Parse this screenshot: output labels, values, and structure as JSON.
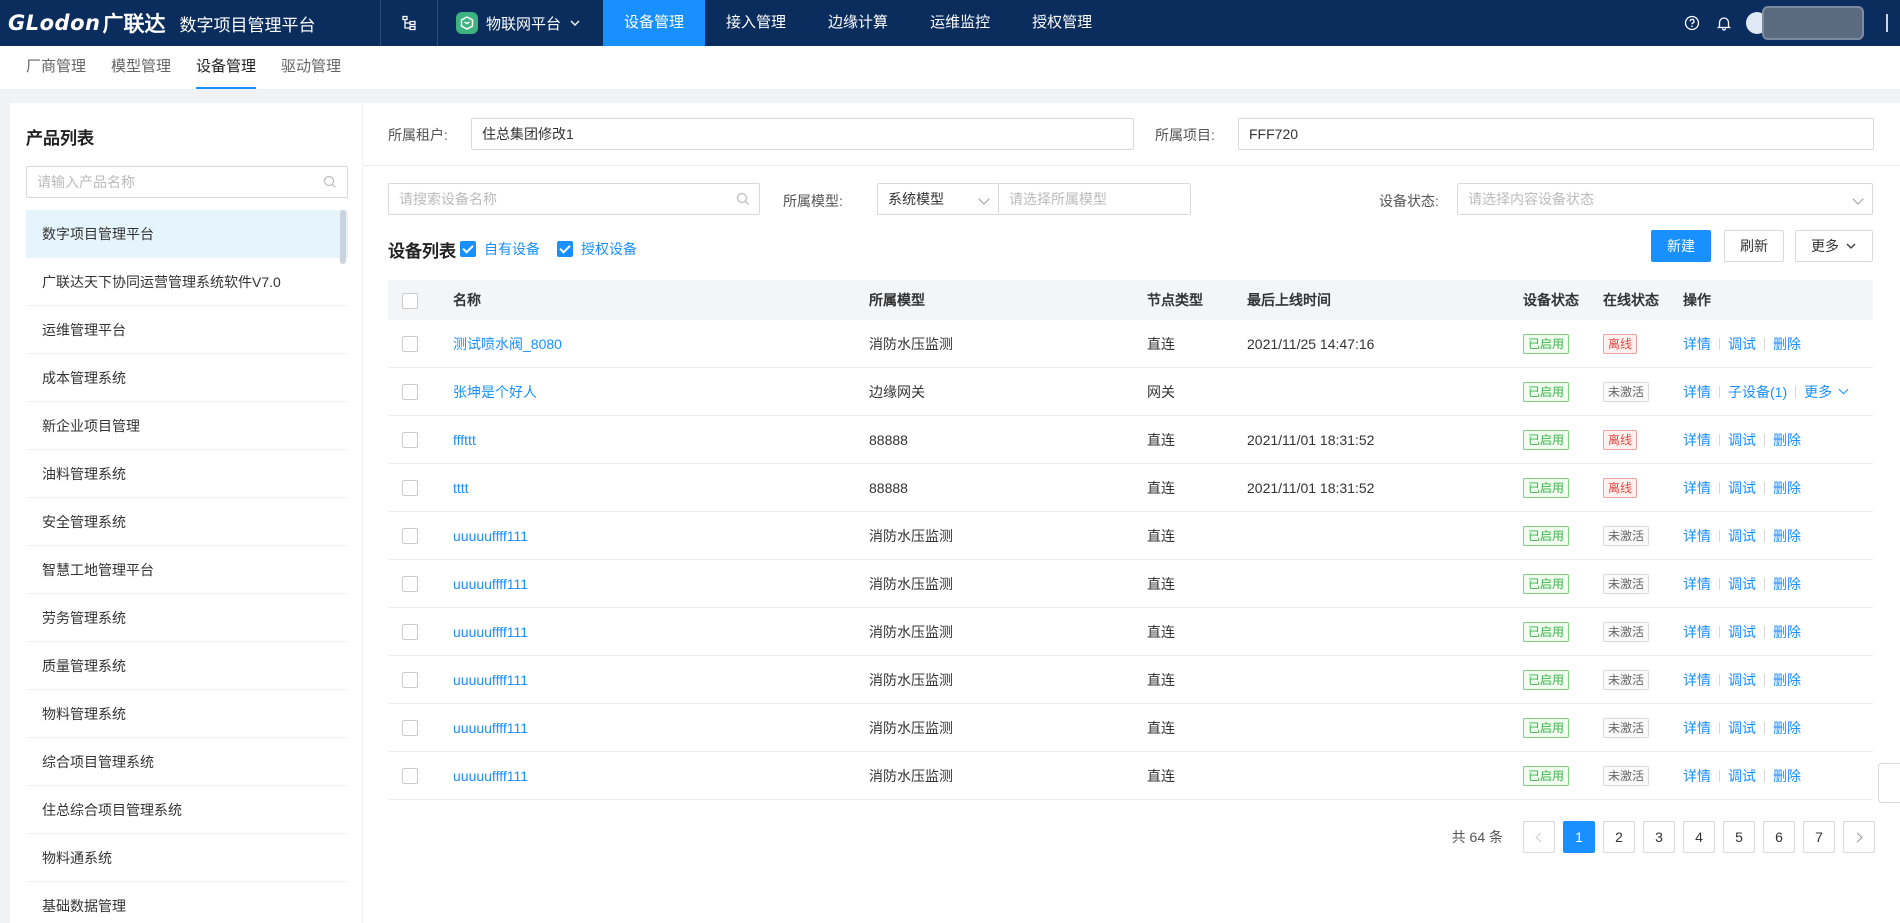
{
  "topbar": {
    "logo_mark": "GLodon",
    "logo_cn": "广联达",
    "app_title": "数字项目管理平台",
    "platform_label": "物联网平台",
    "nav": [
      {
        "label": "设备管理",
        "active": true
      },
      {
        "label": "接入管理",
        "active": false
      },
      {
        "label": "边缘计算",
        "active": false
      },
      {
        "label": "运维监控",
        "active": false
      },
      {
        "label": "授权管理",
        "active": false
      }
    ],
    "icons": [
      "org-tree-icon",
      "help-icon",
      "bell-icon"
    ]
  },
  "subtabs": [
    {
      "label": "厂商管理",
      "active": false
    },
    {
      "label": "模型管理",
      "active": false
    },
    {
      "label": "设备管理",
      "active": true
    },
    {
      "label": "驱动管理",
      "active": false
    }
  ],
  "sidebar": {
    "title": "产品列表",
    "search_placeholder": "请输入产品名称",
    "items": [
      {
        "label": "数字项目管理平台",
        "active": true
      },
      {
        "label": "广联达天下协同运营管理系统软件V7.0",
        "active": false
      },
      {
        "label": "运维管理平台",
        "active": false
      },
      {
        "label": "成本管理系统",
        "active": false
      },
      {
        "label": "新企业项目管理",
        "active": false
      },
      {
        "label": "油料管理系统",
        "active": false
      },
      {
        "label": "安全管理系统",
        "active": false
      },
      {
        "label": "智慧工地管理平台",
        "active": false
      },
      {
        "label": "劳务管理系统",
        "active": false
      },
      {
        "label": "质量管理系统",
        "active": false
      },
      {
        "label": "物料管理系统",
        "active": false
      },
      {
        "label": "综合项目管理系统",
        "active": false
      },
      {
        "label": "住总综合项目管理系统",
        "active": false
      },
      {
        "label": "物料通系统",
        "active": false
      },
      {
        "label": "基础数据管理",
        "active": false
      }
    ]
  },
  "filters": {
    "tenant_label": "所属租户:",
    "tenant_value": "住总集团修改1",
    "project_label": "所属项目:",
    "project_value": "FFF720",
    "device_search_placeholder": "请搜索设备名称",
    "model_label": "所属模型:",
    "model_type_value": "系统模型",
    "model_placeholder": "请选择所属模型",
    "status_label": "设备状态:",
    "status_placeholder": "请选择内容设备状态"
  },
  "device_list": {
    "title": "设备列表",
    "own_label": "自有设备",
    "own_checked": true,
    "auth_label": "授权设备",
    "auth_checked": true,
    "new_button": "新建",
    "refresh_button": "刷新",
    "more_button": "更多"
  },
  "table": {
    "columns": [
      "名称",
      "所属模型",
      "节点类型",
      "最后上线时间",
      "设备状态",
      "在线状态",
      "操作"
    ],
    "rows": [
      {
        "name": "测试喷水阀_8080",
        "model": "消防水压监测",
        "node": "直连",
        "last_online": "2021/11/25 14:47:16",
        "status": "已启用",
        "online": "离线",
        "online_type": "red",
        "ops": [
          "详情",
          "调试",
          "删除"
        ]
      },
      {
        "name": "张坤是个好人",
        "model": "边缘网关",
        "node": "网关",
        "last_online": "",
        "status": "已启用",
        "online": "未激活",
        "online_type": "gray",
        "ops": [
          "详情",
          "子设备(1)",
          "更多"
        ]
      },
      {
        "name": "fffttt",
        "model": "88888",
        "node": "直连",
        "last_online": "2021/11/01 18:31:52",
        "status": "已启用",
        "online": "离线",
        "online_type": "red",
        "ops": [
          "详情",
          "调试",
          "删除"
        ]
      },
      {
        "name": "tttt",
        "model": "88888",
        "node": "直连",
        "last_online": "2021/11/01 18:31:52",
        "status": "已启用",
        "online": "离线",
        "online_type": "red",
        "ops": [
          "详情",
          "调试",
          "删除"
        ]
      },
      {
        "name": "uuuuuffff111",
        "model": "消防水压监测",
        "node": "直连",
        "last_online": "",
        "status": "已启用",
        "online": "未激活",
        "online_type": "gray",
        "ops": [
          "详情",
          "调试",
          "删除"
        ]
      },
      {
        "name": "uuuuuffff111",
        "model": "消防水压监测",
        "node": "直连",
        "last_online": "",
        "status": "已启用",
        "online": "未激活",
        "online_type": "gray",
        "ops": [
          "详情",
          "调试",
          "删除"
        ]
      },
      {
        "name": "uuuuuffff111",
        "model": "消防水压监测",
        "node": "直连",
        "last_online": "",
        "status": "已启用",
        "online": "未激活",
        "online_type": "gray",
        "ops": [
          "详情",
          "调试",
          "删除"
        ]
      },
      {
        "name": "uuuuuffff111",
        "model": "消防水压监测",
        "node": "直连",
        "last_online": "",
        "status": "已启用",
        "online": "未激活",
        "online_type": "gray",
        "ops": [
          "详情",
          "调试",
          "删除"
        ]
      },
      {
        "name": "uuuuuffff111",
        "model": "消防水压监测",
        "node": "直连",
        "last_online": "",
        "status": "已启用",
        "online": "未激活",
        "online_type": "gray",
        "ops": [
          "详情",
          "调试",
          "删除"
        ]
      },
      {
        "name": "uuuuuffff111",
        "model": "消防水压监测",
        "node": "直连",
        "last_online": "",
        "status": "已启用",
        "online": "未激活",
        "online_type": "gray",
        "ops": [
          "详情",
          "调试",
          "删除"
        ]
      }
    ]
  },
  "pagination": {
    "total_text": "共 64 条",
    "pages": [
      "1",
      "2",
      "3",
      "4",
      "5",
      "6",
      "7"
    ],
    "current": "1"
  },
  "colors": {
    "topbar_bg": "#0a2d5e",
    "accent": "#1890ff",
    "status_green": "#3cb34a",
    "status_red": "#e64545"
  }
}
